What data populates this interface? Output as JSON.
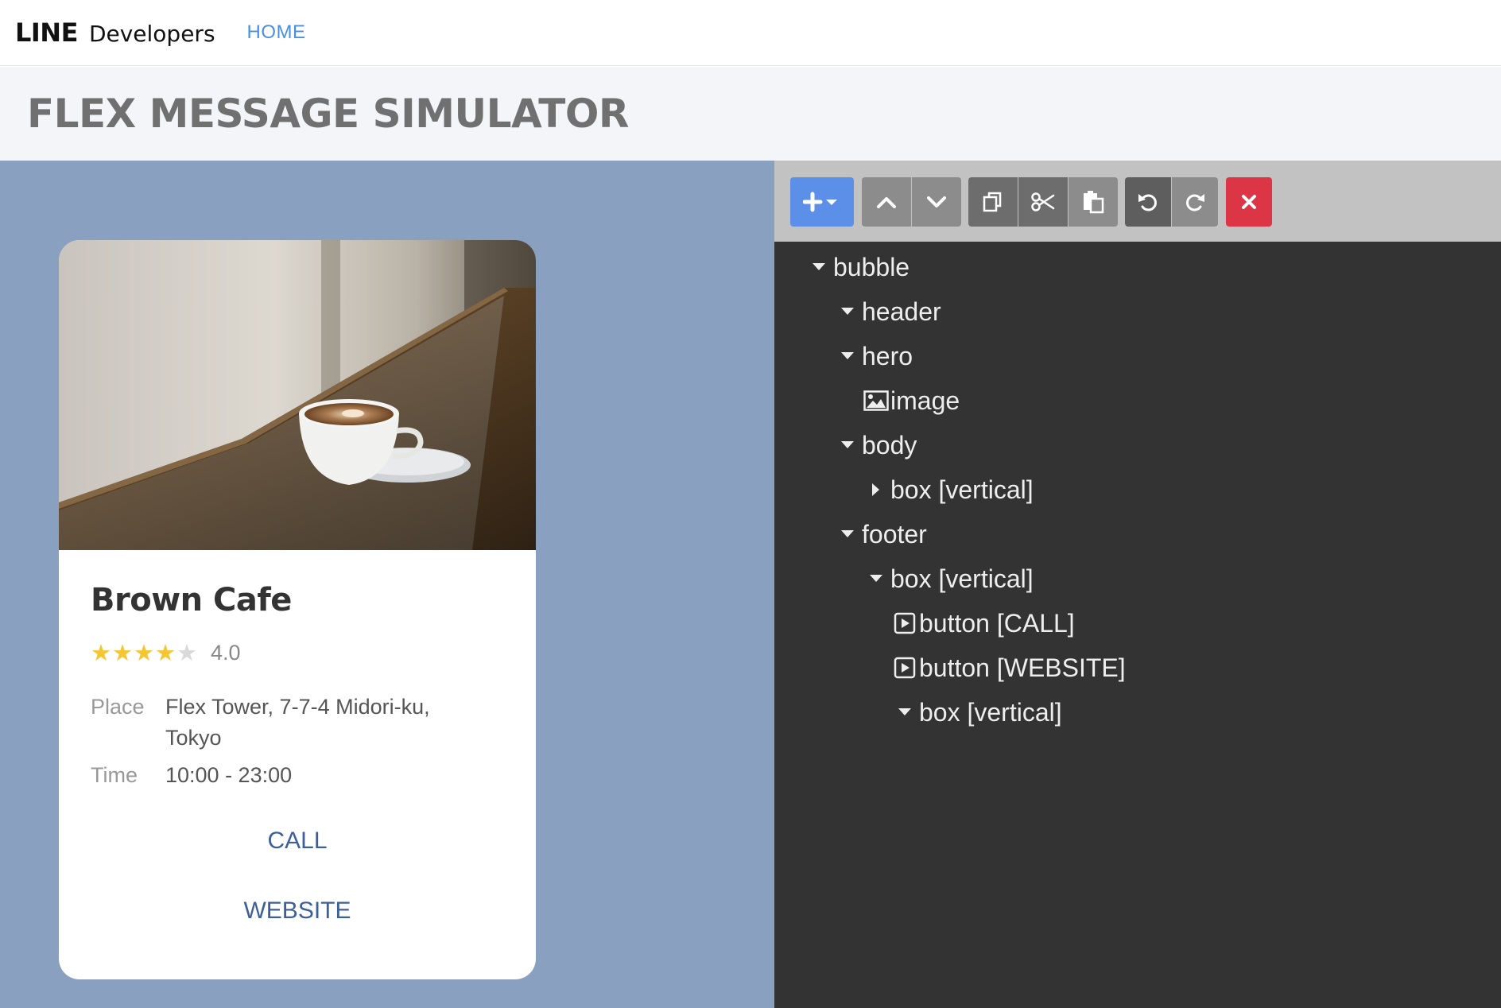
{
  "nav": {
    "logo_bold": "LINE",
    "logo_text": "Developers",
    "home": "HOME"
  },
  "page": {
    "title": "FLEX MESSAGE SIMULATOR"
  },
  "preview": {
    "title": "Brown Cafe",
    "rating_value": 4,
    "rating_max": 5,
    "rating_text": "4.0",
    "place_label": "Place",
    "place_value": "Flex Tower, 7-7-4 Midori-ku, Tokyo",
    "time_label": "Time",
    "time_value": "10:00 - 23:00",
    "buttons": [
      {
        "label": "CALL"
      },
      {
        "label": "WEBSITE"
      }
    ]
  },
  "toolbar": {
    "buttons": [
      {
        "icon": "add-dropdown-icon",
        "color": "#5b8fe8"
      },
      {
        "icon": "move-up-icon",
        "color": "#8c8c8c"
      },
      {
        "icon": "move-down-icon",
        "color": "#8c8c8c"
      },
      {
        "icon": "copy-icon",
        "color": "#6d6d6d"
      },
      {
        "icon": "cut-icon",
        "color": "#6d6d6d"
      },
      {
        "icon": "paste-icon",
        "color": "#8c8c8c"
      },
      {
        "icon": "undo-icon",
        "color": "#5e5e5e"
      },
      {
        "icon": "redo-icon",
        "color": "#8c8c8c"
      },
      {
        "icon": "delete-icon",
        "color": "#dc3545"
      }
    ]
  },
  "tree": [
    {
      "label": "bubble",
      "depth": 0,
      "toggle": "expanded"
    },
    {
      "label": "header",
      "depth": 1,
      "toggle": "expanded"
    },
    {
      "label": "hero",
      "depth": 1,
      "toggle": "expanded"
    },
    {
      "label": "image",
      "depth": 2,
      "toggle": "image"
    },
    {
      "label": "body",
      "depth": 1,
      "toggle": "expanded"
    },
    {
      "label": "box [vertical]",
      "depth": 2,
      "toggle": "collapsed"
    },
    {
      "label": "footer",
      "depth": 1,
      "toggle": "expanded"
    },
    {
      "label": "box [vertical]",
      "depth": 2,
      "toggle": "expanded"
    },
    {
      "label": "button [CALL]",
      "depth": 3,
      "toggle": "button"
    },
    {
      "label": "button [WEBSITE]",
      "depth": 3,
      "toggle": "button"
    },
    {
      "label": "box [vertical]",
      "depth": 3,
      "toggle": "expanded"
    }
  ]
}
